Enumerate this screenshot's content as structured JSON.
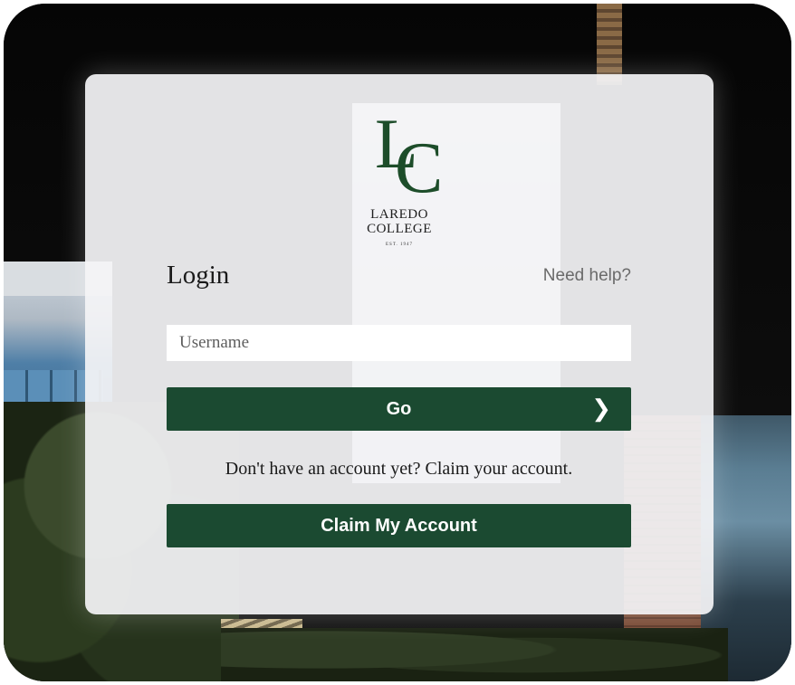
{
  "logo": {
    "initials_l": "L",
    "initials_c": "C",
    "line1": "LAREDO",
    "line2": "COLLEGE",
    "est": "EST. 1947",
    "color": "#1d4d2a"
  },
  "login": {
    "title": "Login",
    "help_link": "Need help?",
    "username_placeholder": "Username",
    "username_value": "",
    "go_label": "Go",
    "go_icon": "chevron-right-icon",
    "claim_prompt": "Don't have an account yet? Claim your account.",
    "claim_button": "Claim My Account"
  },
  "colors": {
    "primary_button": "#1b4a31",
    "card_background": "#f4f4f6"
  }
}
